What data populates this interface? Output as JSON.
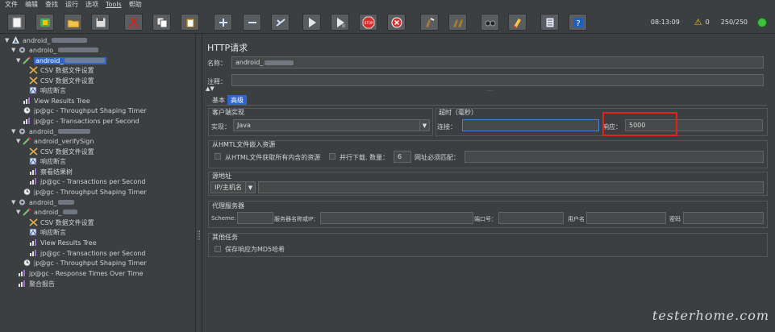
{
  "menu": [
    "文件",
    "编辑",
    "查找",
    "运行",
    "选项",
    "Tools",
    "帮助"
  ],
  "toolbar": {
    "buttons": [
      "new-icon",
      "templates-icon",
      "open-icon",
      "save-icon",
      "cut-icon",
      "copy-icon",
      "paste-icon",
      "expand-icon",
      "collapse-icon",
      "toggle-icon",
      "start-icon",
      "start-no-pause-icon",
      "stop-icon",
      "shutdown-icon",
      "clear-icon",
      "clear-all-icon",
      "search-icon",
      "reset-search-icon",
      "function-helper-icon",
      "help-icon"
    ],
    "time": "08:13:09",
    "warnings": "0",
    "threads": "250/250"
  },
  "tree": [
    {
      "level": 0,
      "label": "android_",
      "blur": 44,
      "icon": "testplan"
    },
    {
      "level": 1,
      "label": "androlo_",
      "blur": 50,
      "icon": "threadgroup"
    },
    {
      "level": 2,
      "label": "android_",
      "blur": 50,
      "icon": "sampler",
      "selected": true
    },
    {
      "level": 3,
      "label": "CSV 数据文件设置",
      "icon": "config"
    },
    {
      "level": 3,
      "label": "CSV 数据文件设置",
      "icon": "config"
    },
    {
      "level": 3,
      "label": "响应断言",
      "icon": "assertion"
    },
    {
      "level": 2,
      "label": "View Results Tree",
      "icon": "listener"
    },
    {
      "level": 2,
      "label": "jp@gc - Throughput Shaping Timer",
      "icon": "timer"
    },
    {
      "level": 2,
      "label": "jp@gc - Transactions per Second",
      "icon": "listener"
    },
    {
      "level": 1,
      "label": "android_",
      "blur": 40,
      "icon": "threadgroup"
    },
    {
      "level": 2,
      "label": "android_verifySign",
      "icon": "sampler"
    },
    {
      "level": 3,
      "label": "CSV 数据文件设置",
      "icon": "config"
    },
    {
      "level": 3,
      "label": "响应断言",
      "icon": "assertion"
    },
    {
      "level": 3,
      "label": "察看结果树",
      "icon": "listener"
    },
    {
      "level": 3,
      "label": "jp@gc - Transactions per Second",
      "icon": "listener"
    },
    {
      "level": 2,
      "label": "jp@gc - Throughput Shaping Timer",
      "icon": "timer"
    },
    {
      "level": 1,
      "label": "android_",
      "blur": 20,
      "icon": "threadgroup"
    },
    {
      "level": 2,
      "label": "android_",
      "blur": 18,
      "icon": "sampler"
    },
    {
      "level": 3,
      "label": "CSV 数据文件设置",
      "icon": "config"
    },
    {
      "level": 3,
      "label": "响应断言",
      "icon": "assertion"
    },
    {
      "level": 3,
      "label": "View Results Tree",
      "icon": "listener"
    },
    {
      "level": 3,
      "label": "jp@gc - Transactions per Second",
      "icon": "listener"
    },
    {
      "level": 2,
      "label": "jp@gc - Throughput Shaping Timer",
      "icon": "timer"
    },
    {
      "level": 1,
      "label": "jp@gc - Response Times Over Time",
      "icon": "listener"
    },
    {
      "level": 1,
      "label": "聚合报告",
      "icon": "listener"
    }
  ],
  "panel": {
    "heading": "HTTP请求",
    "name_label": "名称：",
    "name_value": "android_",
    "comment_label": "注释：",
    "tabs": [
      "基本",
      "高级"
    ],
    "client_group": "客户端实现",
    "impl_label": "实现：",
    "impl_value": "Java",
    "timeout_group": "超时（毫秒）",
    "connect_label": "连接：",
    "response_label": "响应：",
    "response_value": "5000",
    "embedded_group": "从HMTL文件嵌入资源",
    "embedded_cb": "从HTML文件获取所有内含的资源",
    "parallel_cb": "并行下载. 数量：",
    "parallel_count": "6",
    "url_match_label": "网址必须匹配：",
    "source_group": "源地址",
    "ip_select": "IP/主机名",
    "proxy_group": "代理服务器",
    "scheme_label": "Scheme:",
    "proxy_host_label": "服务器名称或IP：",
    "port_label": "端口号：",
    "user_label": "用户名",
    "pass_label": "密码",
    "other_group": "其他任务",
    "md5_cb": "保存响应为MD5哈希"
  },
  "watermark": "testerhome.com",
  "colors": {
    "selection": "#2f65ca",
    "highlight_box": "#e0231b",
    "background": "#3c3f41"
  }
}
